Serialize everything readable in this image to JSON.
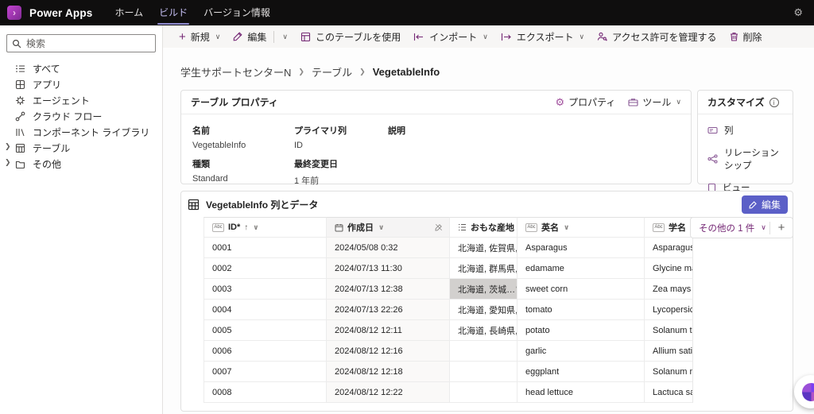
{
  "topbar": {
    "brand": "Power Apps",
    "tabs": [
      {
        "label": "ホーム"
      },
      {
        "label": "ビルド"
      },
      {
        "label": "バージョン情報"
      }
    ],
    "settings_icon": "gear-icon"
  },
  "sidebar": {
    "search_placeholder": "検索",
    "items": [
      {
        "label": "すべて",
        "icon": "list-icon"
      },
      {
        "label": "アプリ",
        "icon": "app-icon"
      },
      {
        "label": "エージェント",
        "icon": "agent-icon"
      },
      {
        "label": "クラウド フロー",
        "icon": "flow-icon"
      },
      {
        "label": "コンポーネント ライブラリ",
        "icon": "library-icon"
      },
      {
        "label": "テーブル",
        "icon": "table-icon",
        "expandable": true
      },
      {
        "label": "その他",
        "icon": "folder-icon",
        "expandable": true
      }
    ]
  },
  "commandbar": {
    "items": [
      {
        "label": "新規",
        "icon": "plus-icon"
      },
      {
        "label": "編集",
        "icon": "pencil-icon"
      },
      {
        "label": "このテーブルを使用",
        "icon": "table-icon"
      },
      {
        "label": "インポート",
        "icon": "import-icon"
      },
      {
        "label": "エクスポート",
        "icon": "export-icon"
      },
      {
        "label": "アクセス許可を管理する",
        "icon": "person-key-icon"
      },
      {
        "label": "削除",
        "icon": "trash-icon"
      }
    ]
  },
  "breadcrumb": {
    "items": [
      "学生サポートセンターN",
      "テーブル",
      "VegetableInfo"
    ]
  },
  "properties_card": {
    "title": "テーブル プロパティ",
    "actions": {
      "properties": "プロパティ",
      "tools": "ツール"
    },
    "fields": {
      "name_label": "名前",
      "name_value": "VegetableInfo",
      "primary_label": "プライマリ列",
      "primary_value": "ID",
      "desc_label": "説明",
      "desc_value": "",
      "type_label": "種類",
      "type_value": "Standard",
      "modified_label": "最終変更日",
      "modified_value": "1 年前"
    }
  },
  "customize_card": {
    "title": "カスタマイズ",
    "items": [
      {
        "label": "列",
        "icon": "column-icon"
      },
      {
        "label": "リレーションシップ",
        "icon": "relationship-icon"
      },
      {
        "label": "ビュー",
        "icon": "view-icon"
      }
    ]
  },
  "grid": {
    "title": "VegetableInfo 列とデータ",
    "edit_button": "編集",
    "more_columns_label": "その他の 1 件",
    "abc_icon_label": "Abc",
    "columns": [
      {
        "label": "ID*",
        "type": "text",
        "sorted": "asc"
      },
      {
        "label": "作成日",
        "type": "date",
        "readonly": true
      },
      {
        "label": "おもな産地",
        "type": "choice"
      },
      {
        "label": "英名",
        "type": "text"
      },
      {
        "label": "学名",
        "type": "text"
      }
    ],
    "rows": [
      [
        "0001",
        "2024/05/08 0:32",
        "北海道, 佐賀県, …",
        "Asparagus",
        "Asparagus off"
      ],
      [
        "0002",
        "2024/07/13 11:30",
        "北海道, 群馬県, …",
        "edamame",
        "Glycine max"
      ],
      [
        "0003",
        "2024/07/13 12:38",
        "北海道, 茨城…",
        "sweet corn",
        "Zea mays"
      ],
      [
        "0004",
        "2024/07/13 22:26",
        "北海道, 愛知県, …",
        "tomato",
        "Lycopersicon"
      ],
      [
        "0005",
        "2024/08/12 12:11",
        "北海道, 長崎県, …",
        "potato",
        "Solanum tube"
      ],
      [
        "0006",
        "2024/08/12 12:16",
        "",
        "garlic",
        "Allium sativum"
      ],
      [
        "0007",
        "2024/08/12 12:18",
        "",
        "eggplant",
        "Solanum melo"
      ],
      [
        "0008",
        "2024/08/12 12:22",
        "",
        "head lettuce",
        "Lactuca sativa"
      ]
    ]
  }
}
